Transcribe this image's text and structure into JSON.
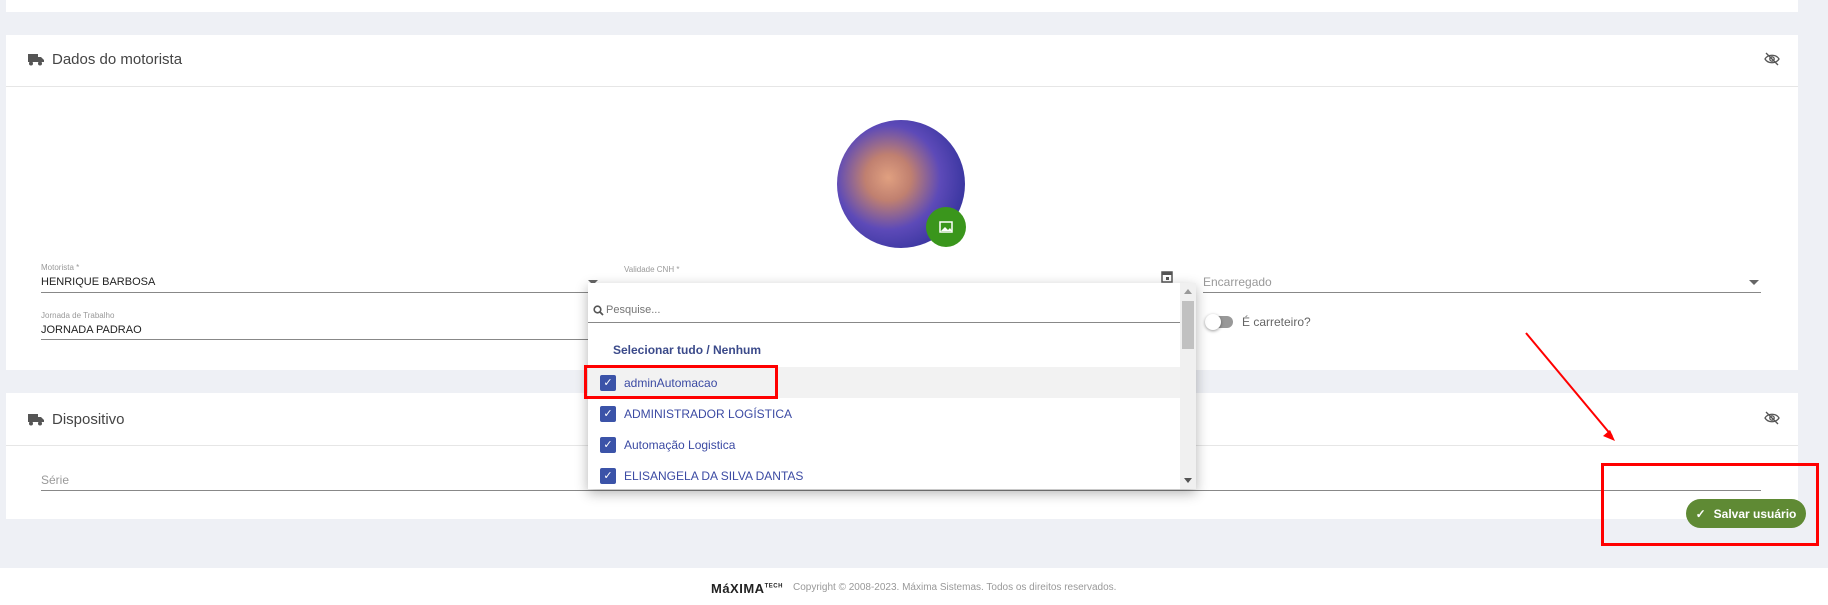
{
  "driver_section": {
    "title": "Dados do motorista",
    "motorista": {
      "label": "Motorista *",
      "value": "HENRIQUE BARBOSA"
    },
    "validade_cnh": {
      "label": "Validade CNH *"
    },
    "encarregado": {
      "placeholder": "Encarregado"
    },
    "jornada": {
      "label": "Jornada de Trabalho",
      "value": "JORNADA PADRAO"
    },
    "carreteiro": {
      "label": "É carreteiro?",
      "on": false
    }
  },
  "device_section": {
    "title": "Dispositivo",
    "serie": {
      "placeholder": "Série"
    }
  },
  "dropdown": {
    "search_placeholder": "Pesquise...",
    "select_all": "Selecionar tudo / Nenhum",
    "items": [
      {
        "label": "adminAutomacao",
        "checked": true
      },
      {
        "label": "ADMINISTRADOR LOGÍSTICA",
        "checked": true
      },
      {
        "label": "Automação Logistica",
        "checked": true
      },
      {
        "label": "ELISANGELA DA SILVA DANTAS",
        "checked": true
      }
    ]
  },
  "save_button": {
    "label": "Salvar usuário"
  },
  "footer": {
    "logo": "MáXIMA TECH",
    "copyright": "Copyright © 2008-2023. Máxima Sistemas. Todos os direitos reservados."
  },
  "colors": {
    "accent": "#3b53a8",
    "save": "#5f8a34",
    "photo": "#3a961c",
    "annotation": "#ff0000"
  }
}
